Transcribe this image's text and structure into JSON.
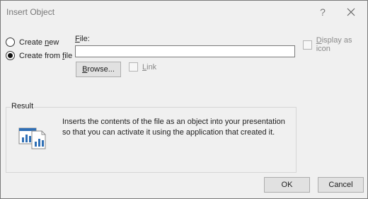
{
  "dialog": {
    "title": "Insert Object",
    "help_label": "?",
    "close_icon": "close-icon"
  },
  "options": {
    "create_new": {
      "prefix": "Create ",
      "mnemonic": "n",
      "suffix": "ew",
      "selected": false
    },
    "create_from_file": {
      "prefix": "Create from ",
      "mnemonic": "f",
      "suffix": "ile",
      "selected": true
    }
  },
  "file": {
    "label_mnemonic": "F",
    "label_rest": "ile:",
    "value": "",
    "browse_mnemonic": "B",
    "browse_rest": "rowse..."
  },
  "link": {
    "mnemonic": "L",
    "rest": "ink",
    "checked": false,
    "enabled": false
  },
  "display_as_icon": {
    "mnemonic": "D",
    "rest": "isplay as icon",
    "checked": false,
    "enabled": false
  },
  "result": {
    "title": "Result",
    "text": "Inserts the contents of the file as an object into your presentation so that you can activate it using the application that created it.",
    "icon": "file-object-icon"
  },
  "buttons": {
    "ok": "OK",
    "cancel": "Cancel"
  },
  "colors": {
    "dialog_bg": "#f0f0f0",
    "button_bg": "#e1e1e1",
    "disabled_text": "#8a8a8a",
    "icon_blue": "#2f6fb5"
  }
}
